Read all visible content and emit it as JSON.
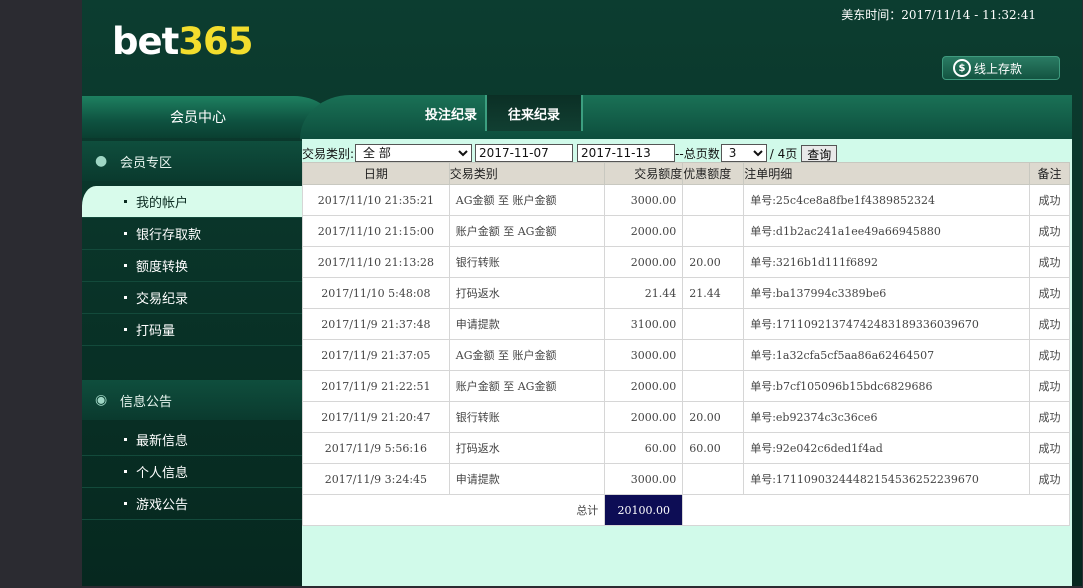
{
  "header": {
    "logo_white": "bet",
    "logo_yellow": "365",
    "datetime": "美东时间：2017/11/14 - 11:32:41",
    "deposit_label": "线上存款",
    "deposit_icon": "dollar-coin-icon"
  },
  "member_center": "会员中心",
  "tabs": [
    "投注纪录",
    "往来纪录"
  ],
  "sidebar": {
    "section1": {
      "title": "会员专区",
      "icon": "user-icon",
      "items": [
        "我的帐户",
        "银行存取款",
        "额度转换",
        "交易纪录",
        "打码量"
      ]
    },
    "section2": {
      "title": "信息公告",
      "icon": "chat-icon",
      "items": [
        "最新信息",
        "个人信息",
        "游戏公告"
      ]
    }
  },
  "filter": {
    "type_label": "交易类别:",
    "type_value": "全 部",
    "date_from": "2017-11-07",
    "date_to": "2017-11-13",
    "pages_label": "--总页数",
    "page_value": "3",
    "pages_total": "/ 4页",
    "query_label": "查询"
  },
  "table": {
    "headers": [
      "日期",
      "交易类别",
      "交易额度",
      "优惠额度",
      "注单明细",
      "备注"
    ],
    "rows": [
      [
        "2017/11/10 21:35:21",
        "AG金额 至 账户金额",
        "3000.00",
        "",
        "单号:25c4ce8a8fbe1f4389852324",
        "成功"
      ],
      [
        "2017/11/10 21:15:00",
        "账户金额 至 AG金额",
        "2000.00",
        "",
        "单号:d1b2ac241a1ee49a66945880",
        "成功"
      ],
      [
        "2017/11/10 21:13:28",
        "银行转账",
        "2000.00",
        "20.00",
        "单号:3216b1d111f6892",
        "成功"
      ],
      [
        "2017/11/10 5:48:08",
        "打码返水",
        "21.44",
        "21.44",
        "单号:ba137994c3389be6",
        "成功"
      ],
      [
        "2017/11/9 21:37:48",
        "申请提款",
        "3100.00",
        "",
        "单号:171109213747424831893360396​70",
        "成功"
      ],
      [
        "2017/11/9 21:37:05",
        "AG金额 至 账户金额",
        "3000.00",
        "",
        "单号:1a32cfa5cf5aa86a62464507",
        "成功"
      ],
      [
        "2017/11/9 21:22:51",
        "账户金额 至 AG金额",
        "2000.00",
        "",
        "单号:b7cf105096b15bdc6829686",
        "成功"
      ],
      [
        "2017/11/9 21:20:47",
        "银行转账",
        "2000.00",
        "20.00",
        "单号:eb92374c3c36ce6",
        "成功"
      ],
      [
        "2017/11/9 5:56:16",
        "打码返水",
        "60.00",
        "60.00",
        "单号:92e042c6ded1f4ad",
        "成功"
      ],
      [
        "2017/11/9 3:24:45",
        "申请提款",
        "3000.00",
        "",
        "单号:171109032444821545362522396​70",
        "成功"
      ]
    ],
    "total_label": "总计",
    "total_value": "20100.00"
  }
}
